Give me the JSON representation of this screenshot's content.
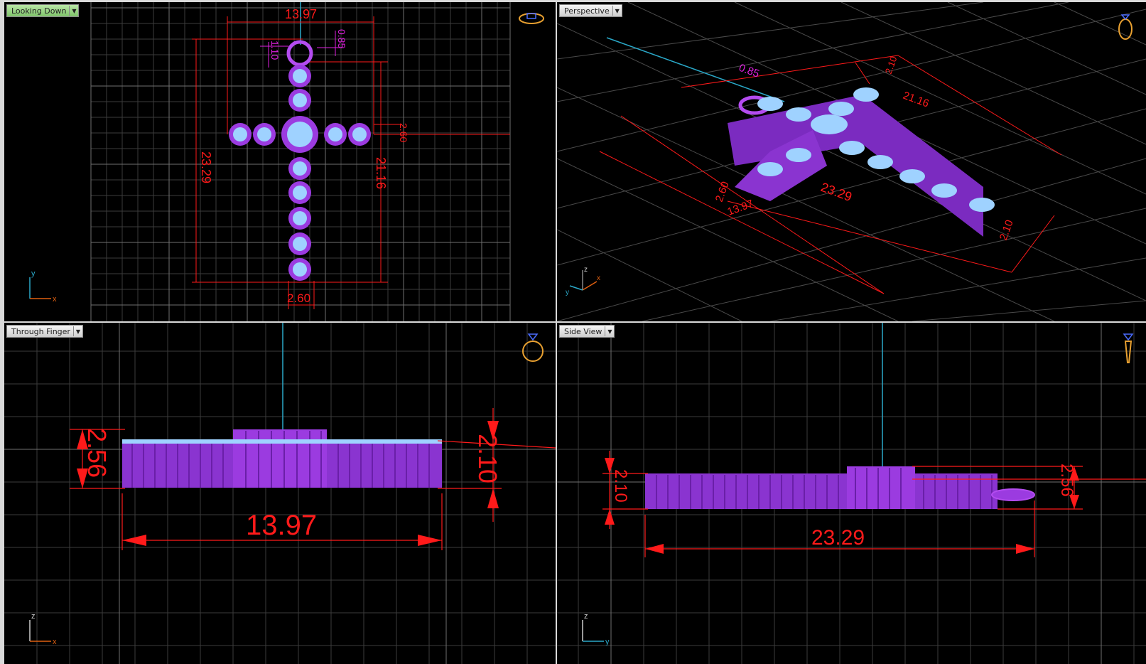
{
  "viewports": {
    "top": {
      "label": "Looking Down",
      "axes": {
        "h": "x",
        "v": "y"
      },
      "dims": {
        "width": "13.97",
        "height": "23.29",
        "arm_height": "21.16",
        "bail_outer": "1.10",
        "bail_inner": "0.85",
        "bar_width": "2.60",
        "bottom_width": "2.60"
      }
    },
    "perspective": {
      "label": "Perspective",
      "axes": {
        "a": "z",
        "b": "y",
        "c": "x"
      },
      "dims": {
        "d1": "0.85",
        "d2": "21.16",
        "d3": "23.29",
        "d4": "2.60",
        "d5": "13.97",
        "d6": "2.10",
        "d7": "2.10"
      }
    },
    "front": {
      "label": "Through Finger",
      "axes": {
        "h": "x",
        "v": "z"
      },
      "dims": {
        "height_left": "2.56",
        "height_right": "2.10",
        "width": "13.97"
      }
    },
    "side": {
      "label": "Side View",
      "axes": {
        "h": "y",
        "v": "z"
      },
      "dims": {
        "height_left": "2.10",
        "height_right": "2.56",
        "length": "23.29"
      }
    }
  },
  "colors": {
    "grid": "#3a3a3a",
    "grid_major": "#6c6c6c",
    "dim": "#ff1a1a",
    "body": "#9b3be0",
    "stone": "#9fd2ff",
    "axis_x": "#e06010",
    "axis_y": "#2aa8c8",
    "icon": "#e8a030"
  },
  "icons": [
    "ring-top-icon",
    "ring-perspective-icon",
    "ring-front-icon",
    "ring-side-icon"
  ]
}
